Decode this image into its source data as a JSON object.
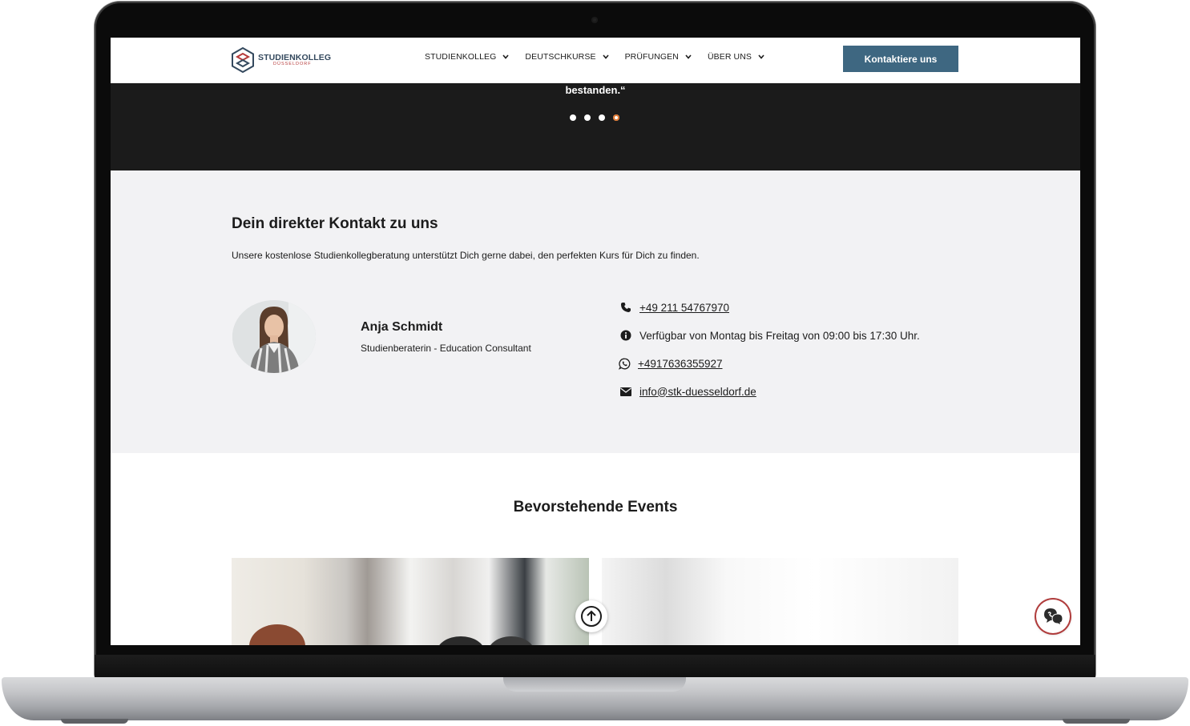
{
  "header": {
    "logo": {
      "main": "STUDIENKOLLEG",
      "sub": "DÜSSELDORF"
    },
    "nav": [
      "STUDIENKOLLEG",
      "DEUTSCHKURSE",
      "PRÜFUNGEN",
      "ÜBER UNS"
    ],
    "cta_label": "Kontaktiere uns"
  },
  "testimonial": {
    "quote_tail": "bestanden.“",
    "slides_total": 4,
    "active_slide": 4
  },
  "contact": {
    "title": "Dein direkter Kontakt zu uns",
    "intro": "Unsere kostenlose Studienkollegberatung unterstützt Dich gerne dabei, den perfekten Kurs für Dich zu finden.",
    "person": {
      "name": "Anja Schmidt",
      "role": "Studienberaterin - Education Consultant"
    },
    "phone": "+49 211 54767970",
    "hours": "Verfügbar von Montag bis Freitag von 09:00 bis 17:30 Uhr.",
    "whatsapp": "+4917636355927",
    "email": "info@stk-duesseldorf.de"
  },
  "events": {
    "title": "Bevorstehende Events"
  },
  "colors": {
    "accent": "#3e6781",
    "dark_band": "#1b1b1b",
    "contact_bg": "#f2f2f4",
    "logo_red": "#b63a3a",
    "active_dot": "#e0772f"
  },
  "icons": [
    "chevron-down-icon",
    "phone-icon",
    "info-icon",
    "whatsapp-icon",
    "mail-icon",
    "arrow-up-icon",
    "chat-icon"
  ]
}
